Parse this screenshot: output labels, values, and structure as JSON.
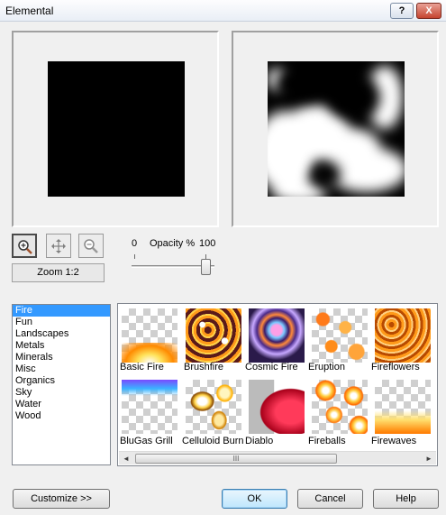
{
  "window": {
    "title": "Elemental",
    "help_label": "?",
    "close_label": "X"
  },
  "previews": [
    {
      "name": "preview-original",
      "content": "black square"
    },
    {
      "name": "preview-effect",
      "content": "cloud texture"
    }
  ],
  "tools": [
    {
      "name": "zoom-in-icon",
      "active": true
    },
    {
      "name": "pan-icon",
      "active": false
    },
    {
      "name": "zoom-out-icon",
      "active": false
    }
  ],
  "zoom": {
    "label": "Zoom 1:2"
  },
  "opacity": {
    "min_label": "0",
    "title": "Opacity %",
    "max_label": "100",
    "value": 100
  },
  "categories": {
    "items": [
      "Fire",
      "Fun",
      "Landscapes",
      "Metals",
      "Minerals",
      "Misc",
      "Organics",
      "Sky",
      "Water",
      "Wood"
    ],
    "selected": "Fire"
  },
  "thumbnails": [
    {
      "label": "Basic Fire",
      "style": "basic-fire"
    },
    {
      "label": "Brushfire",
      "style": "brushfire"
    },
    {
      "label": "Cosmic Fire",
      "style": "cosmic-fire"
    },
    {
      "label": "Eruption",
      "style": "eruption"
    },
    {
      "label": "Fireflowers",
      "style": "fireflowers"
    },
    {
      "label": "BluGas Grill",
      "style": "blugas-grill"
    },
    {
      "label": "Celluloid Burn",
      "style": "celluloid-burn"
    },
    {
      "label": "Diablo",
      "style": "diablo"
    },
    {
      "label": "Fireballs",
      "style": "fireballs"
    },
    {
      "label": "Firewaves",
      "style": "firewaves"
    }
  ],
  "scrollbar": {
    "left_arrow": "◄",
    "right_arrow": "►",
    "grip": "III"
  },
  "buttons": {
    "customize": "Customize   >>",
    "ok": "OK",
    "cancel": "Cancel",
    "help": "Help"
  },
  "colors": {
    "selection": "#3399ff",
    "dialog_bg": "#f0f0f0"
  }
}
